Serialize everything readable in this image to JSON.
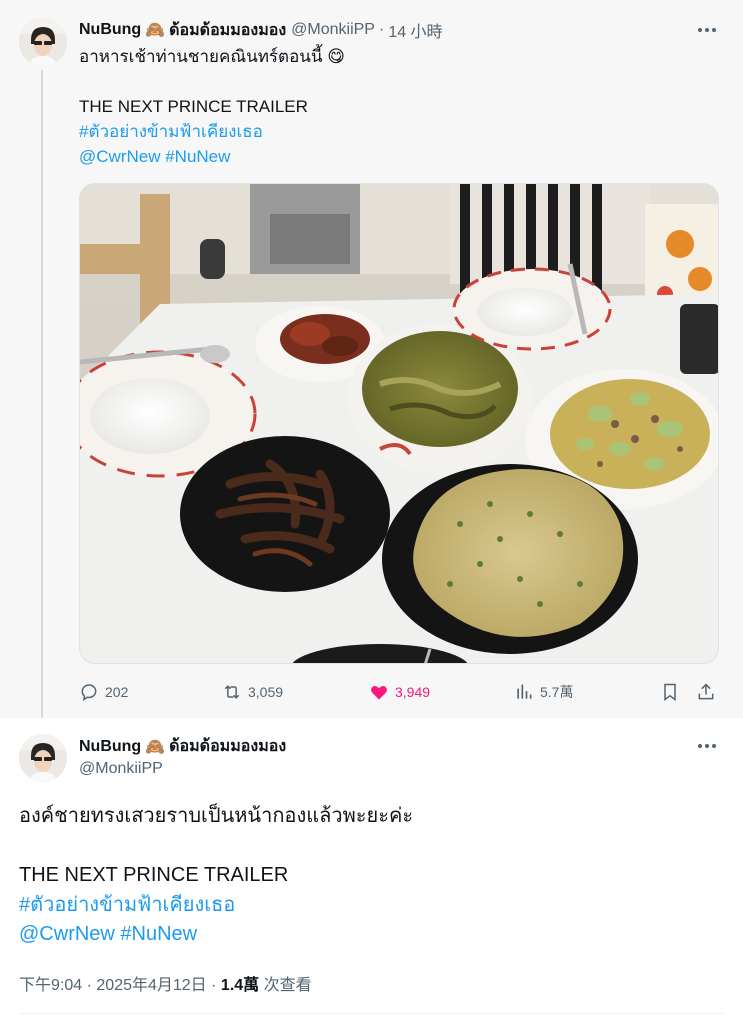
{
  "parent": {
    "author_name": "NuBung",
    "author_emoji": "🙈",
    "author_extra": "ด้อมด้อมมองมอง",
    "handle": "@MonkiiPP",
    "separator": "·",
    "time": "14 小時",
    "text_line1": "อาหารเช้าท่านชายคณินทร์ตอนนี้ 😋",
    "text_line2": "THE NEXT PRINCE TRAILER",
    "hashtag1": "#ตัวอย่างข้ามฟ้าเคียงเธอ",
    "mention": "@CwrNew",
    "hashtag2": "#NuNew",
    "image_alt": "food-photo",
    "actions": {
      "replies": "202",
      "reposts": "3,059",
      "likes": "3,949",
      "views": "5.7萬"
    }
  },
  "main": {
    "author_name": "NuBung",
    "author_emoji": "🙈",
    "author_extra": "ด้อมด้อมมองมอง",
    "handle": "@MonkiiPP",
    "text_line1": "องค์ชายทรงเสวยราบเป็นหน้ากองแล้วพะยะค่ะ",
    "text_line2": "THE NEXT PRINCE TRAILER",
    "hashtag1": "#ตัวอย่างข้ามฟ้าเคียงเธอ",
    "mention": "@CwrNew",
    "hashtag2": "#NuNew",
    "time": "下午9:04",
    "date": "2025年4月12日",
    "separator": "·",
    "views_count": "1.4萬",
    "views_label": "次查看"
  },
  "colors": {
    "link": "#1d9bf0",
    "like": "#f91880",
    "muted": "#536471",
    "text": "#0f1419"
  },
  "icons": [
    "more-icon",
    "reply-icon",
    "repost-icon",
    "like-icon",
    "views-icon",
    "bookmark-icon",
    "share-icon"
  ]
}
